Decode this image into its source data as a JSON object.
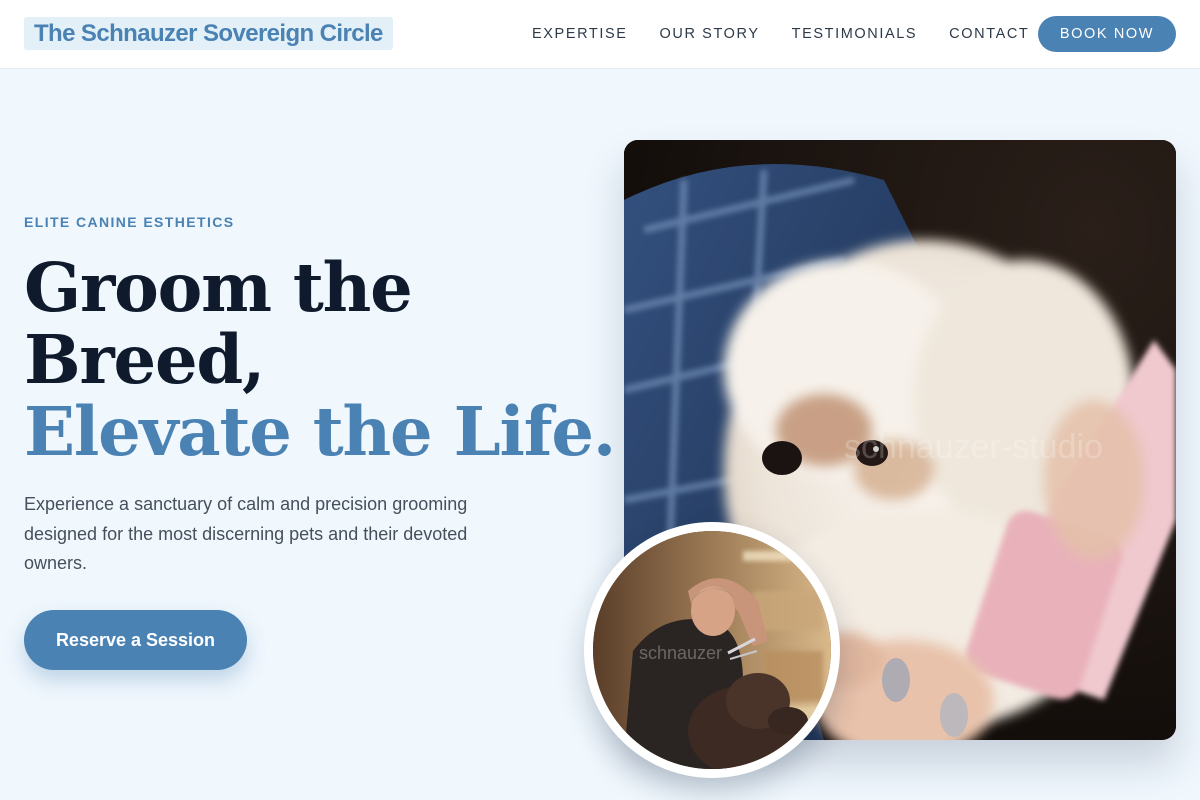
{
  "header": {
    "brand": "The Schnauzer Sovereign Circle",
    "nav": [
      "EXPERTISE",
      "OUR STORY",
      "TESTIMONIALS",
      "CONTACT"
    ],
    "book_button": "BOOK NOW"
  },
  "hero": {
    "eyebrow": "ELITE CANINE ESTHETICS",
    "headline_line1": "Groom the",
    "headline_line2": "Breed,",
    "headline_accent": "Elevate the Life.",
    "lead": "Experience a sanctuary of calm and precision grooming designed for the most discerning pets and their devoted owners.",
    "cta": "Reserve a Session"
  },
  "images": {
    "main_watermark": "schnauzer-studio",
    "inset_watermark": "schnauzer"
  },
  "colors": {
    "accent": "#4a82b4",
    "page_bg": "#f0f7fd",
    "heading": "#0f1b2d",
    "body_text": "#46505c"
  }
}
